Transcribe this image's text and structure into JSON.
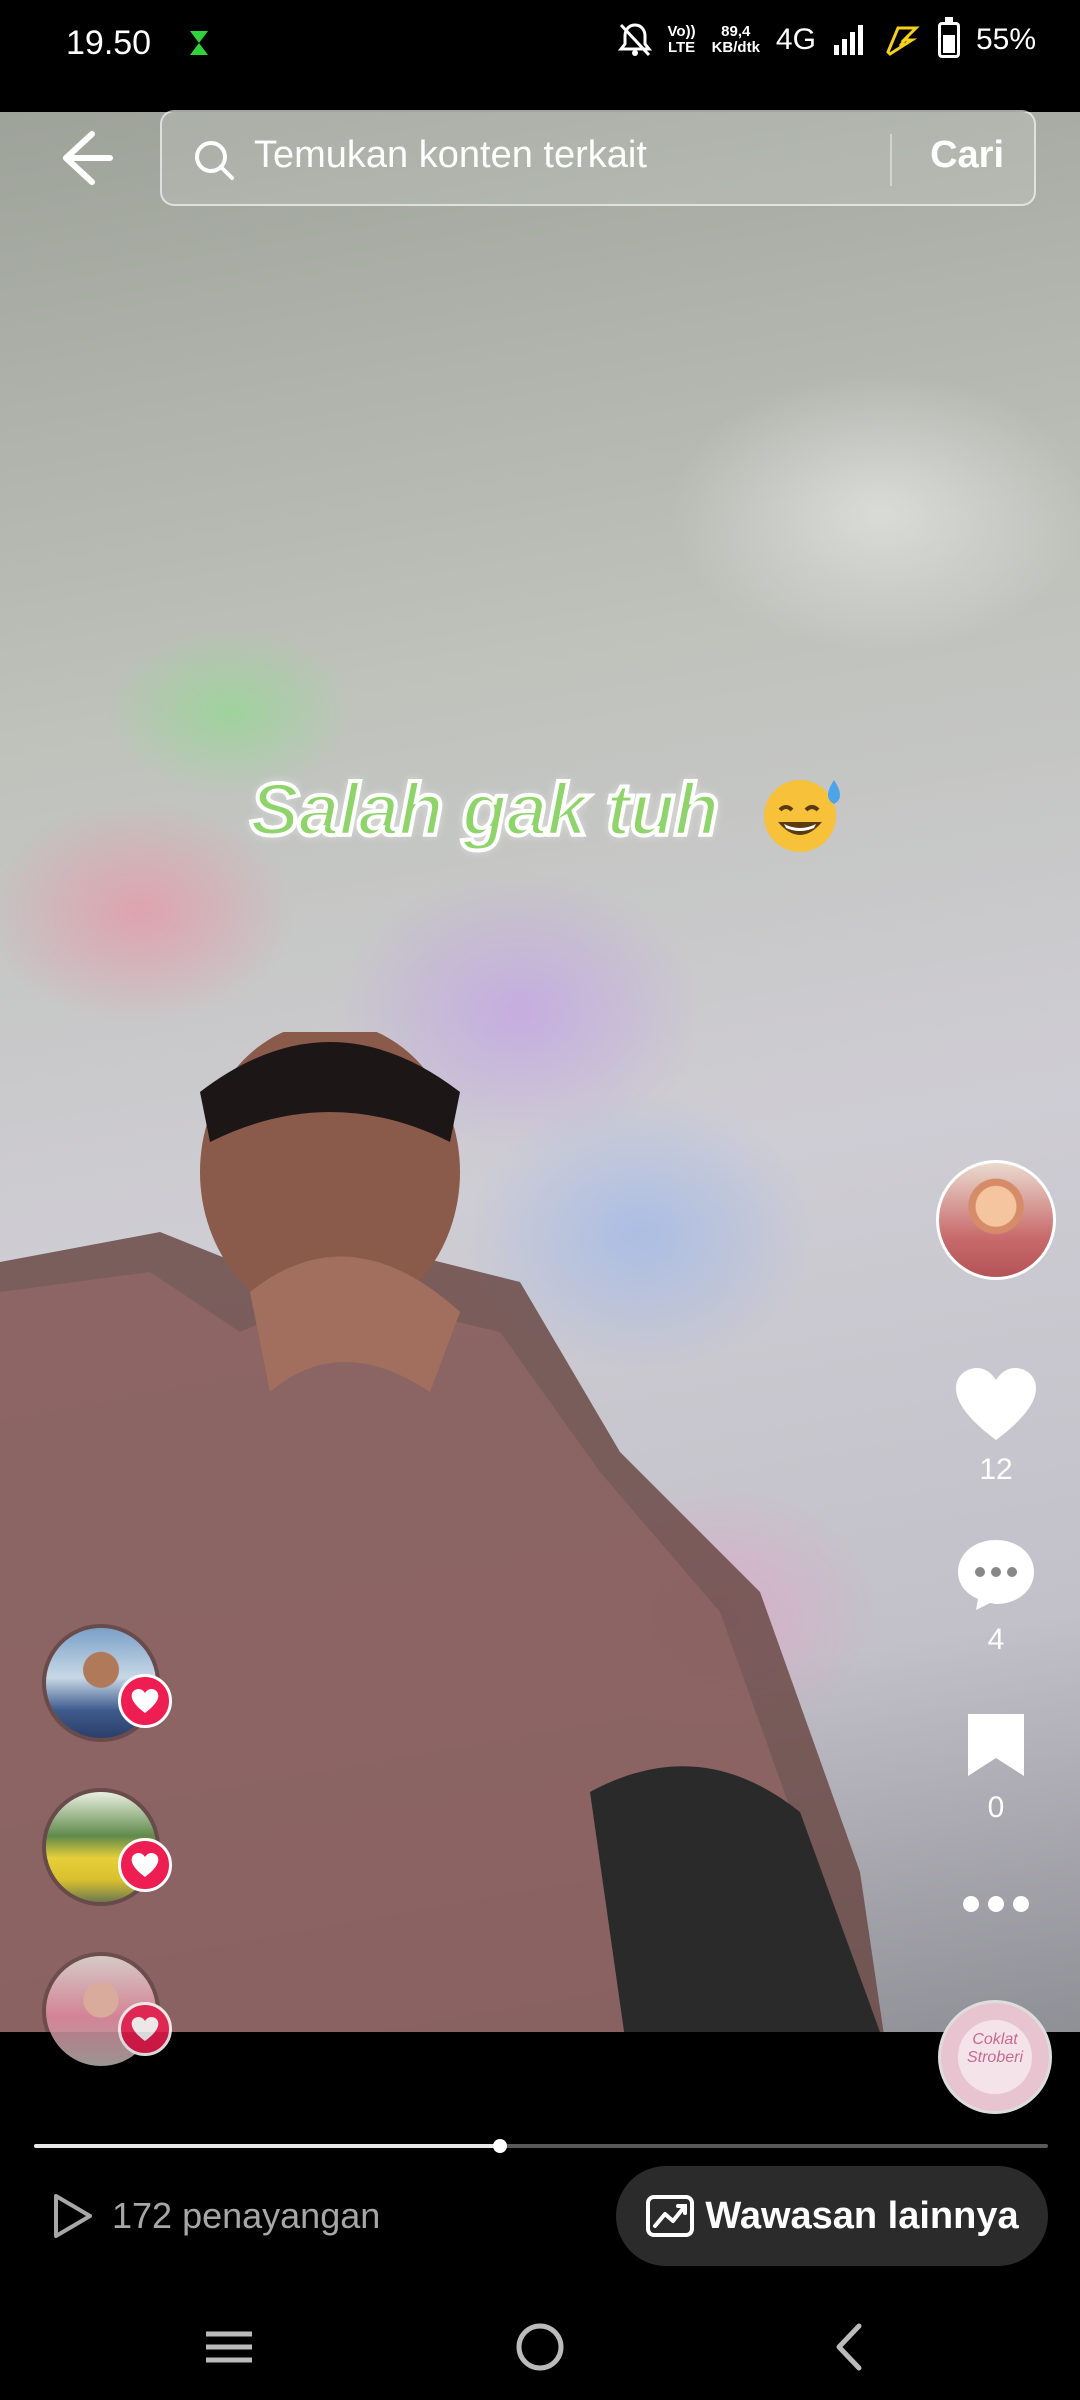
{
  "status_bar": {
    "time": "19.50",
    "volte_top": "Vo))",
    "volte_bottom": "LTE",
    "data_rate_value": "89,4",
    "data_rate_unit": "KB/dtk",
    "network": "4G",
    "battery": "55%"
  },
  "search": {
    "placeholder": "Temukan konten terkait",
    "button_label": "Cari"
  },
  "video": {
    "caption": "Salah gak tuh"
  },
  "actions": {
    "likes": "12",
    "comments": "4",
    "saves": "0"
  },
  "music_disc": {
    "line1": "Coklat",
    "line2": "Stroberi"
  },
  "playback": {
    "progress": 0.46
  },
  "footer": {
    "views_label": "172 penayangan",
    "insights_label": "Wawasan lainnya"
  },
  "colors": {
    "like_red": "#ee1d52",
    "caption_green": "#8fd46b",
    "insights_bg": "#2b2b2b"
  }
}
